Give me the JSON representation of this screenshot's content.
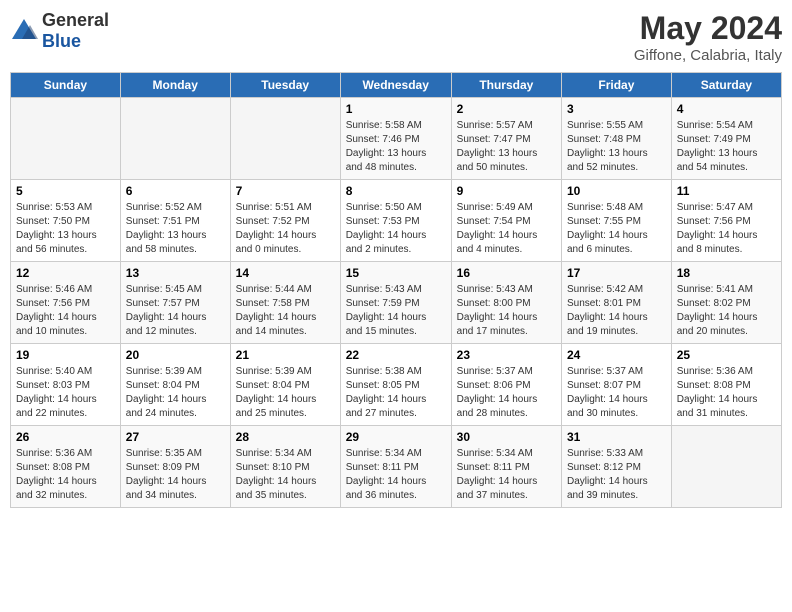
{
  "logo": {
    "general": "General",
    "blue": "Blue"
  },
  "header": {
    "month": "May 2024",
    "location": "Giffone, Calabria, Italy"
  },
  "weekdays": [
    "Sunday",
    "Monday",
    "Tuesday",
    "Wednesday",
    "Thursday",
    "Friday",
    "Saturday"
  ],
  "weeks": [
    [
      {
        "day": "",
        "info": ""
      },
      {
        "day": "",
        "info": ""
      },
      {
        "day": "",
        "info": ""
      },
      {
        "day": "1",
        "info": "Sunrise: 5:58 AM\nSunset: 7:46 PM\nDaylight: 13 hours\nand 48 minutes."
      },
      {
        "day": "2",
        "info": "Sunrise: 5:57 AM\nSunset: 7:47 PM\nDaylight: 13 hours\nand 50 minutes."
      },
      {
        "day": "3",
        "info": "Sunrise: 5:55 AM\nSunset: 7:48 PM\nDaylight: 13 hours\nand 52 minutes."
      },
      {
        "day": "4",
        "info": "Sunrise: 5:54 AM\nSunset: 7:49 PM\nDaylight: 13 hours\nand 54 minutes."
      }
    ],
    [
      {
        "day": "5",
        "info": "Sunrise: 5:53 AM\nSunset: 7:50 PM\nDaylight: 13 hours\nand 56 minutes."
      },
      {
        "day": "6",
        "info": "Sunrise: 5:52 AM\nSunset: 7:51 PM\nDaylight: 13 hours\nand 58 minutes."
      },
      {
        "day": "7",
        "info": "Sunrise: 5:51 AM\nSunset: 7:52 PM\nDaylight: 14 hours\nand 0 minutes."
      },
      {
        "day": "8",
        "info": "Sunrise: 5:50 AM\nSunset: 7:53 PM\nDaylight: 14 hours\nand 2 minutes."
      },
      {
        "day": "9",
        "info": "Sunrise: 5:49 AM\nSunset: 7:54 PM\nDaylight: 14 hours\nand 4 minutes."
      },
      {
        "day": "10",
        "info": "Sunrise: 5:48 AM\nSunset: 7:55 PM\nDaylight: 14 hours\nand 6 minutes."
      },
      {
        "day": "11",
        "info": "Sunrise: 5:47 AM\nSunset: 7:56 PM\nDaylight: 14 hours\nand 8 minutes."
      }
    ],
    [
      {
        "day": "12",
        "info": "Sunrise: 5:46 AM\nSunset: 7:56 PM\nDaylight: 14 hours\nand 10 minutes."
      },
      {
        "day": "13",
        "info": "Sunrise: 5:45 AM\nSunset: 7:57 PM\nDaylight: 14 hours\nand 12 minutes."
      },
      {
        "day": "14",
        "info": "Sunrise: 5:44 AM\nSunset: 7:58 PM\nDaylight: 14 hours\nand 14 minutes."
      },
      {
        "day": "15",
        "info": "Sunrise: 5:43 AM\nSunset: 7:59 PM\nDaylight: 14 hours\nand 15 minutes."
      },
      {
        "day": "16",
        "info": "Sunrise: 5:43 AM\nSunset: 8:00 PM\nDaylight: 14 hours\nand 17 minutes."
      },
      {
        "day": "17",
        "info": "Sunrise: 5:42 AM\nSunset: 8:01 PM\nDaylight: 14 hours\nand 19 minutes."
      },
      {
        "day": "18",
        "info": "Sunrise: 5:41 AM\nSunset: 8:02 PM\nDaylight: 14 hours\nand 20 minutes."
      }
    ],
    [
      {
        "day": "19",
        "info": "Sunrise: 5:40 AM\nSunset: 8:03 PM\nDaylight: 14 hours\nand 22 minutes."
      },
      {
        "day": "20",
        "info": "Sunrise: 5:39 AM\nSunset: 8:04 PM\nDaylight: 14 hours\nand 24 minutes."
      },
      {
        "day": "21",
        "info": "Sunrise: 5:39 AM\nSunset: 8:04 PM\nDaylight: 14 hours\nand 25 minutes."
      },
      {
        "day": "22",
        "info": "Sunrise: 5:38 AM\nSunset: 8:05 PM\nDaylight: 14 hours\nand 27 minutes."
      },
      {
        "day": "23",
        "info": "Sunrise: 5:37 AM\nSunset: 8:06 PM\nDaylight: 14 hours\nand 28 minutes."
      },
      {
        "day": "24",
        "info": "Sunrise: 5:37 AM\nSunset: 8:07 PM\nDaylight: 14 hours\nand 30 minutes."
      },
      {
        "day": "25",
        "info": "Sunrise: 5:36 AM\nSunset: 8:08 PM\nDaylight: 14 hours\nand 31 minutes."
      }
    ],
    [
      {
        "day": "26",
        "info": "Sunrise: 5:36 AM\nSunset: 8:08 PM\nDaylight: 14 hours\nand 32 minutes."
      },
      {
        "day": "27",
        "info": "Sunrise: 5:35 AM\nSunset: 8:09 PM\nDaylight: 14 hours\nand 34 minutes."
      },
      {
        "day": "28",
        "info": "Sunrise: 5:34 AM\nSunset: 8:10 PM\nDaylight: 14 hours\nand 35 minutes."
      },
      {
        "day": "29",
        "info": "Sunrise: 5:34 AM\nSunset: 8:11 PM\nDaylight: 14 hours\nand 36 minutes."
      },
      {
        "day": "30",
        "info": "Sunrise: 5:34 AM\nSunset: 8:11 PM\nDaylight: 14 hours\nand 37 minutes."
      },
      {
        "day": "31",
        "info": "Sunrise: 5:33 AM\nSunset: 8:12 PM\nDaylight: 14 hours\nand 39 minutes."
      },
      {
        "day": "",
        "info": ""
      }
    ]
  ]
}
